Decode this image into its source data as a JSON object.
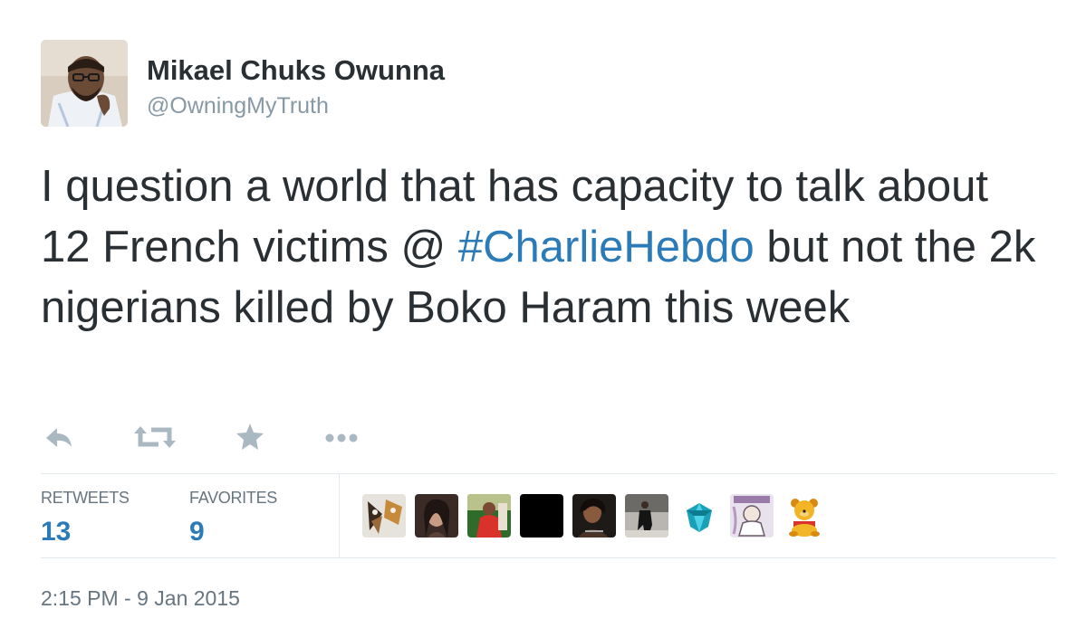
{
  "author": {
    "full_name": "Mikael Chuks Owunna",
    "username": "@OwningMyTruth"
  },
  "tweet": {
    "text_1": "I question a world that has capacity to talk about 12 French victims @ ",
    "hashtag": "#CharlieHebdo",
    "text_2": " but not the 2k nigerians killed by Boko Haram this week"
  },
  "actions": [
    "reply-icon",
    "retweet-icon",
    "favorite-star-icon",
    "more-dots-icon"
  ],
  "stats": {
    "retweets_label": "RETWEETS",
    "retweets_count": "13",
    "favorites_label": "FAVORITES",
    "favorites_count": "9"
  },
  "favoriters_count": 9,
  "timestamp": "2:15 PM - 9 Jan 2015",
  "colors": {
    "link": "#2b7bb9",
    "text": "#292f33",
    "muted": "#8899a6",
    "icon": "#aab8c2",
    "divider": "#e1e8ed"
  }
}
